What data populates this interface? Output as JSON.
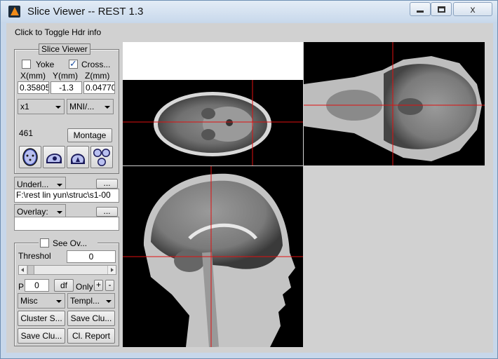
{
  "window": {
    "title": "Slice Viewer -- REST 1.3",
    "close_glyph": "x"
  },
  "header": {
    "hdr_info": "Click to Toggle Hdr info"
  },
  "slice_viewer": {
    "legend": "Slice Viewer",
    "yoke_label": "Yoke",
    "yoke_checked": false,
    "cross_label": "Cross...",
    "cross_checked": true,
    "x_label": "X(mm)",
    "y_label": "Y(mm)",
    "z_label": "Z(mm)",
    "x_value": "0.35805",
    "y_value": "-1.3",
    "z_value": "0.04770",
    "zoom_value": "x1",
    "space_value": "MNI/...",
    "slice_number": "461",
    "montage_label": "Montage",
    "view_icons": [
      "axial-view-icon",
      "sagittal-view-icon",
      "coronal-view-icon",
      "three-views-icon"
    ]
  },
  "underlay": {
    "dropdown_value": "Underl...",
    "browse_label": "...",
    "path_value": "F:\\rest lin yun\\struc\\s1-00"
  },
  "overlay": {
    "dropdown_value": "Overlay:",
    "browse_label": "...",
    "path_value": ""
  },
  "overlay_panel": {
    "see_overlay_label": "See Ov...",
    "see_overlay_checked": false,
    "threshold_label": "Threshol",
    "threshold_value": "0",
    "threshold_slider_level": 0.0,
    "p_label": "P",
    "p_value": "0",
    "df_label": "df",
    "only_label": "Only",
    "plus_label": "+",
    "minus_label": "-",
    "misc_value": "Misc",
    "template_value": "Templ...",
    "cluster_size_label": "Cluster S...",
    "save_cluster_label": "Save Clu...",
    "save_clusters_label": "Save Clu...",
    "cluster_report_label": "Cl. Report"
  },
  "colors": {
    "window_frame": "#c7d7ea",
    "client_bg": "#d1d1d1",
    "crosshair": "#e01010",
    "image_bg": "#000000"
  }
}
